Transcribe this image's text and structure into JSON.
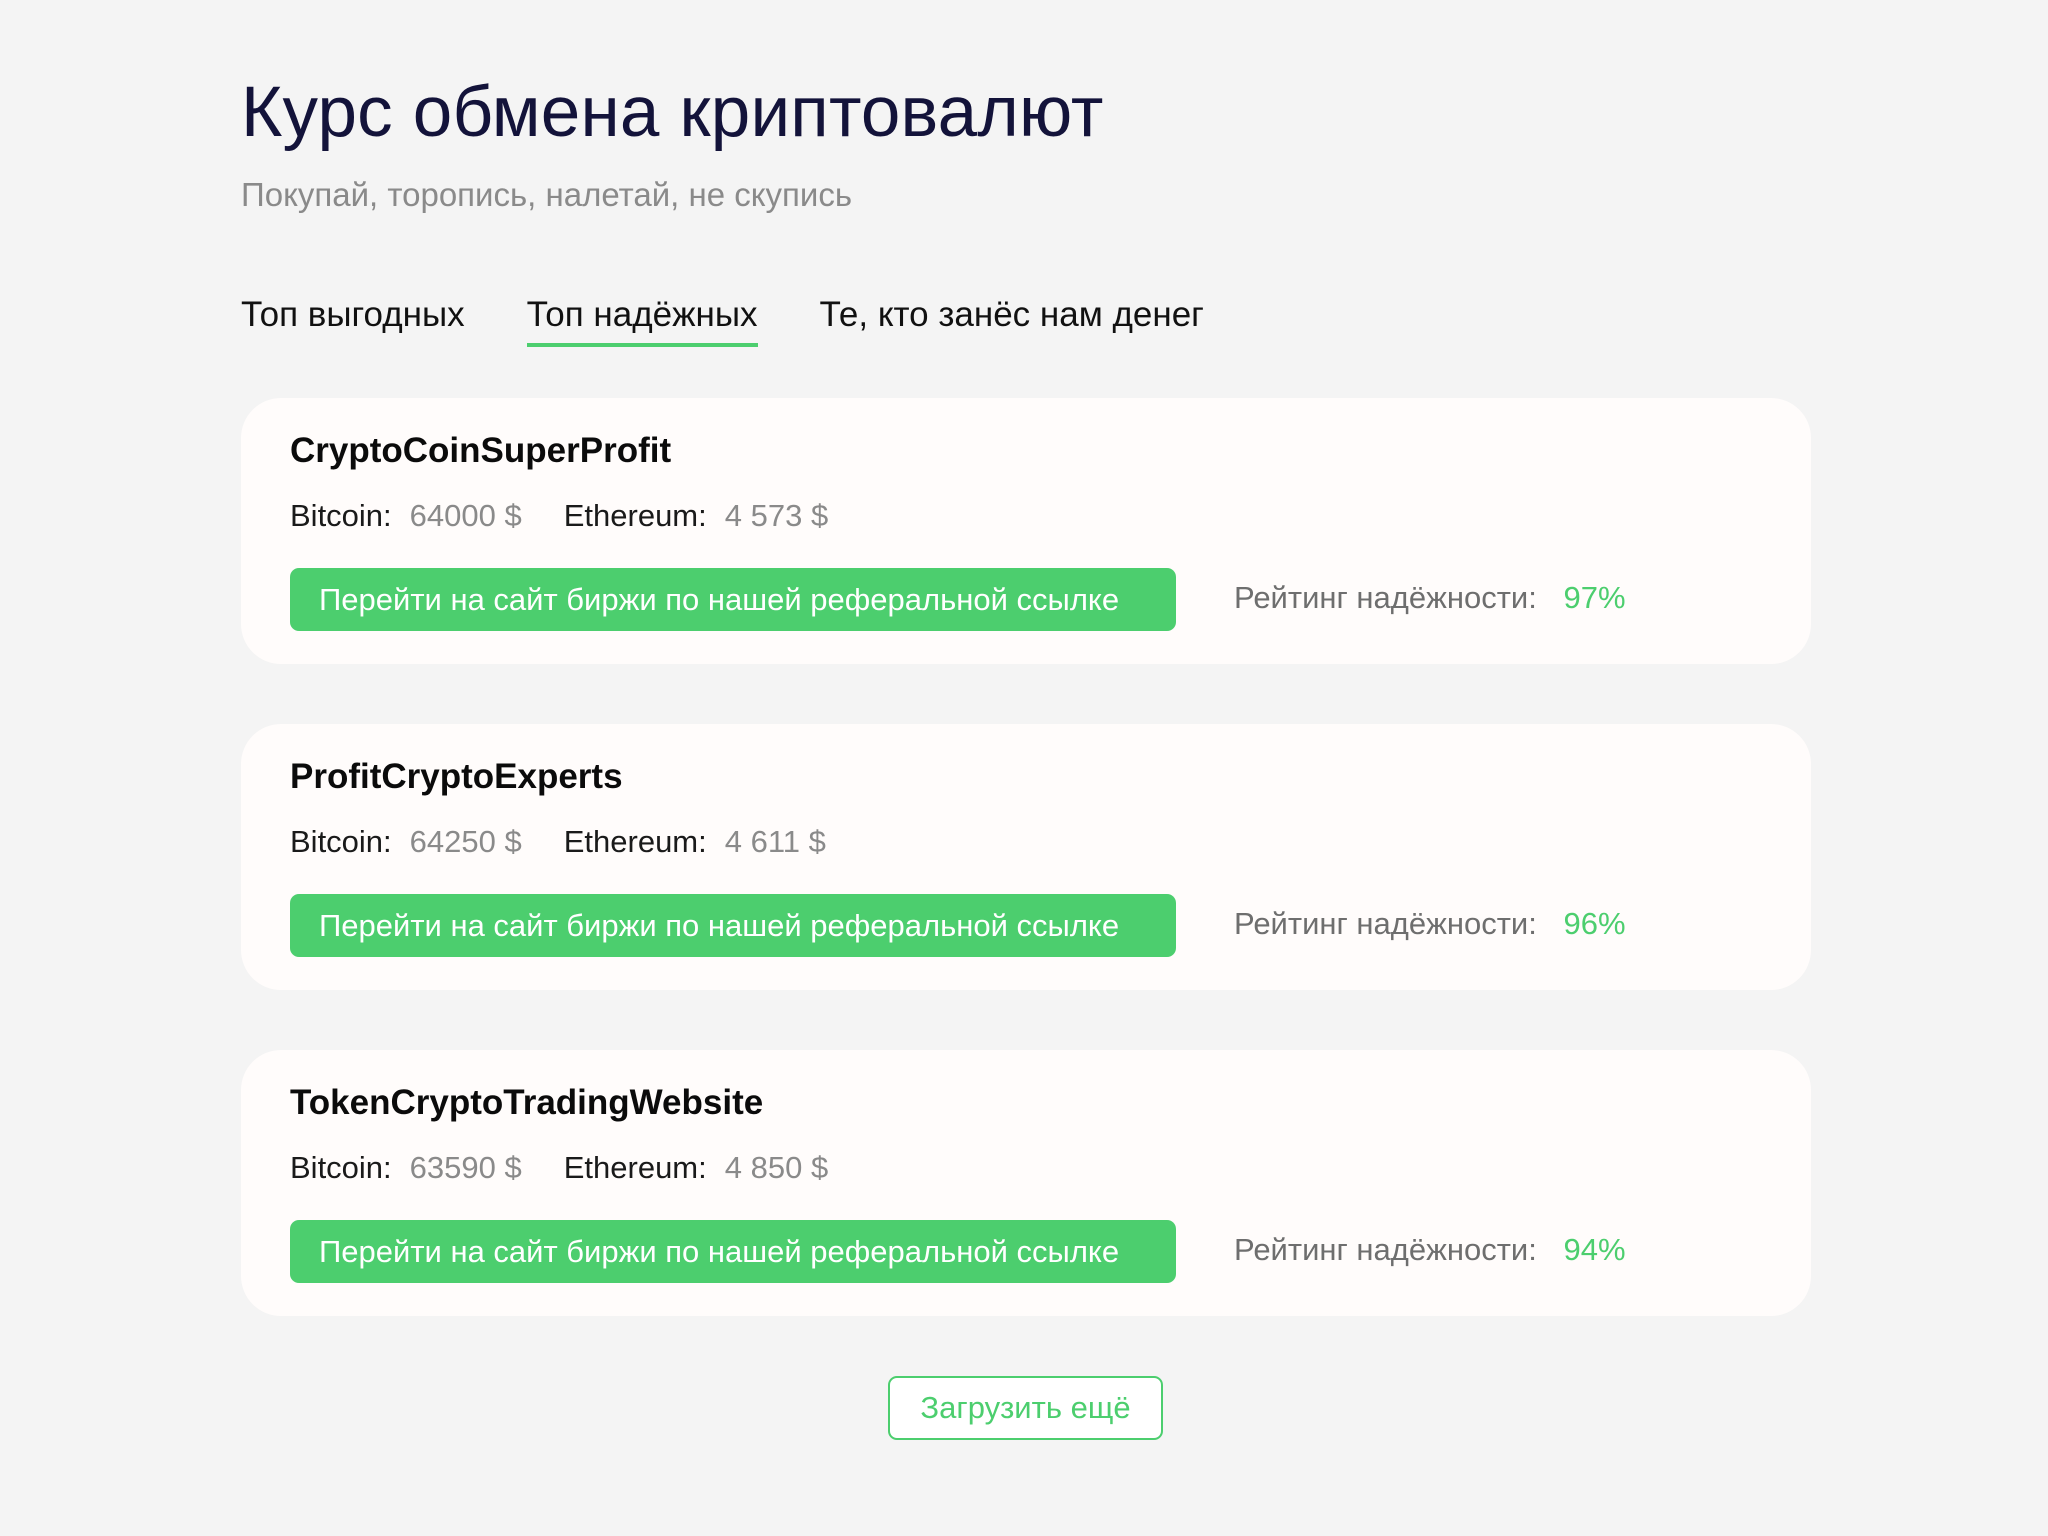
{
  "header": {
    "title": "Курс обмена криптовалют",
    "subtitle": "Покупай, торопись, налетай, не скупись"
  },
  "tabs": [
    {
      "label": "Топ выгодных",
      "active": false
    },
    {
      "label": "Топ надёжных",
      "active": true
    },
    {
      "label": "Те, кто занёс нам денег",
      "active": false
    }
  ],
  "exchanges": [
    {
      "name": "CryptoCoinSuperProfit",
      "bitcoin_label": "Bitcoin:",
      "bitcoin_value": "64000 $",
      "ethereum_label": "Ethereum:",
      "ethereum_value": "4 573 $",
      "button_label": "Перейти на сайт биржи по нашей реферальной ссылке",
      "rating_label": "Рейтинг надёжности:",
      "rating_value": "97%"
    },
    {
      "name": "ProfitCryptoExperts",
      "bitcoin_label": "Bitcoin:",
      "bitcoin_value": "64250 $",
      "ethereum_label": "Ethereum:",
      "ethereum_value": "4 611 $",
      "button_label": "Перейти на сайт биржи по нашей реферальной ссылке",
      "rating_label": "Рейтинг надёжности:",
      "rating_value": "96%"
    },
    {
      "name": "TokenCryptoTradingWebsite",
      "bitcoin_label": "Bitcoin:",
      "bitcoin_value": "63590 $",
      "ethereum_label": "Ethereum:",
      "ethereum_value": "4 850 $",
      "button_label": "Перейти на сайт биржи по нашей реферальной ссылке",
      "rating_label": "Рейтинг надёжности:",
      "rating_value": "94%"
    }
  ],
  "load_more_label": "Загрузить ещё",
  "colors": {
    "accent": "#4cce6e",
    "background": "#f4f4f4",
    "card": "#fffcfb",
    "title": "#13133a",
    "muted": "#8a8a8a"
  }
}
